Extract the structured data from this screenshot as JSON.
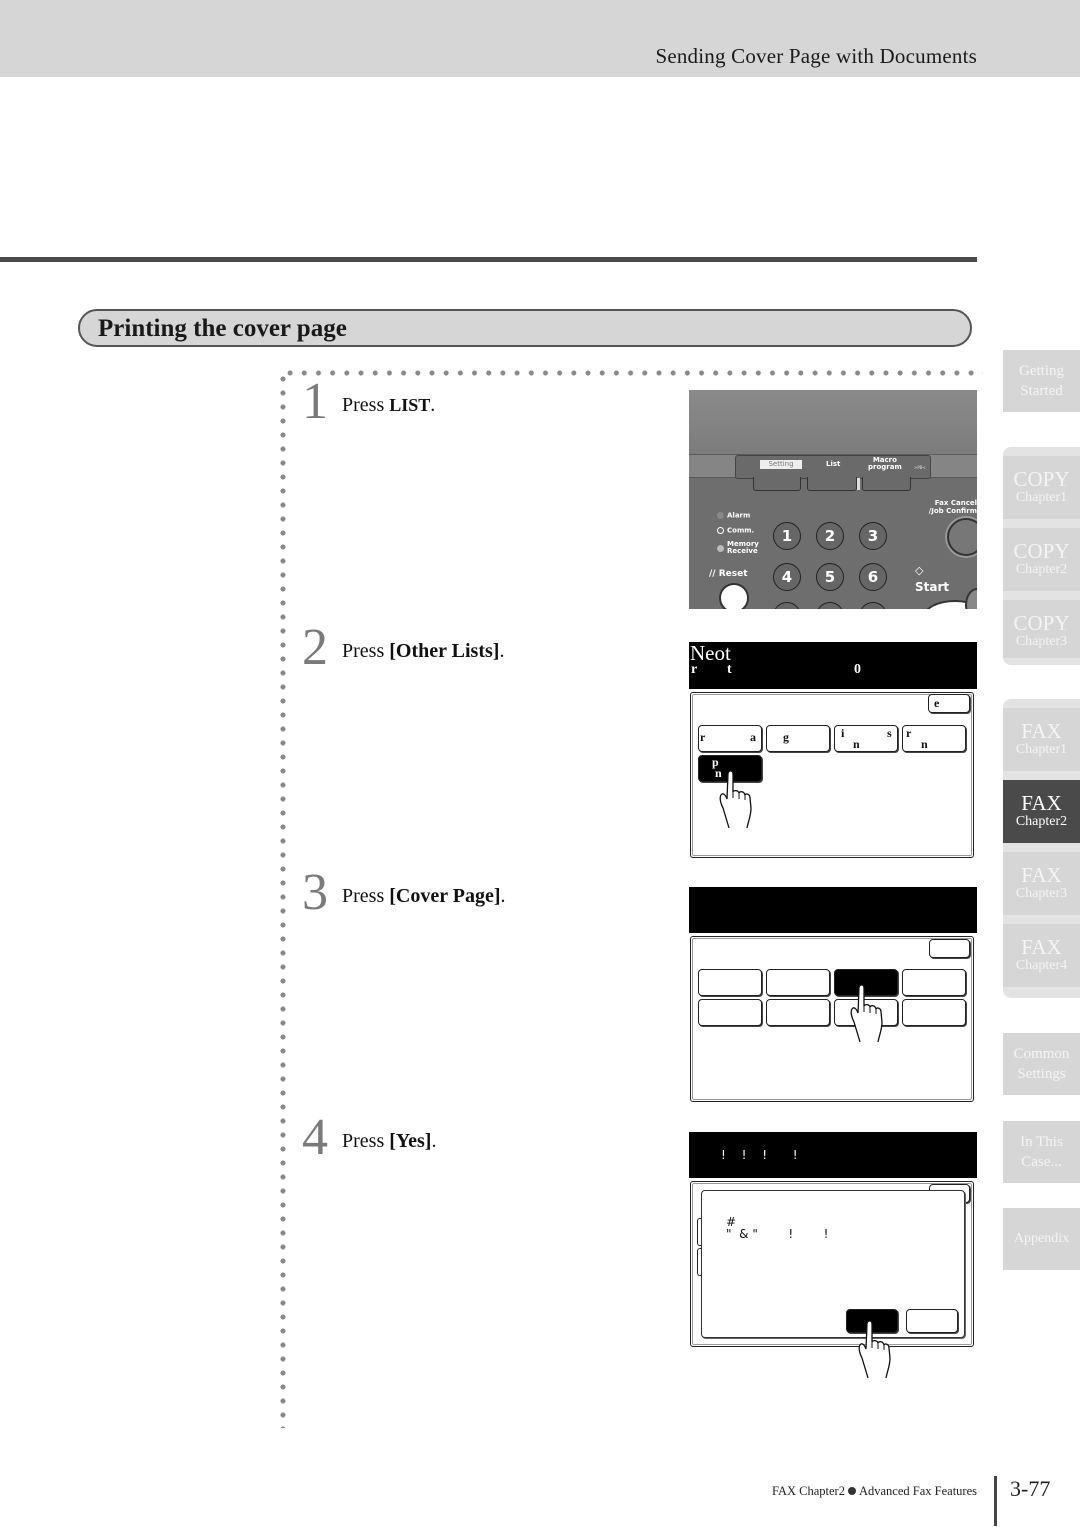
{
  "header": {
    "title": "Sending Cover Page with Documents"
  },
  "section": {
    "title": "Printing the cover page"
  },
  "steps": [
    {
      "number": "1",
      "prefix": "Press ",
      "key": "LIST",
      "suffix": "."
    },
    {
      "number": "2",
      "prefix": "Press ",
      "open": "[",
      "key": "Other Lists",
      "close": "]",
      "suffix": "."
    },
    {
      "number": "3",
      "prefix": "Press ",
      "open": "[",
      "key": "Cover Page",
      "close": "]",
      "suffix": "."
    },
    {
      "number": "4",
      "prefix": "Press ",
      "open": "[",
      "key": "Yes",
      "close": "]",
      "suffix": "."
    }
  ],
  "control_panel": {
    "keys": {
      "setting": "Setting",
      "list": "List",
      "macro_line1": "Macro",
      "macro_line2": "program",
      "pb": ">PB<"
    },
    "leds": [
      "Alarm",
      "Comm.",
      "Memory",
      "Receive"
    ],
    "number_keys": [
      "1",
      "2",
      "3",
      "4",
      "5",
      "6"
    ],
    "fax_cancel_line1": "Fax Cancel",
    "fax_cancel_line2": "/Job Confirm",
    "reset": "// Reset",
    "start": "Start"
  },
  "screen2": {
    "head_line1": "Neot",
    "head_line2a": "r",
    "head_line2b": "t",
    "head_line2c": "0",
    "close_button": "e",
    "buttons": [
      {
        "t1": "r",
        "t2": "a"
      },
      {
        "t1": "g"
      },
      {
        "t1": "i",
        "t2": "s",
        "t3": "n"
      },
      {
        "t1": "r",
        "t3": "n"
      },
      {
        "t1": "p",
        "t3": "n"
      }
    ]
  },
  "screen4": {
    "head": "! ! !  !",
    "msg_line1": "#",
    "msg_line2": "\"  & \"        !        !"
  },
  "sidebar": {
    "tabs": [
      {
        "line1": "Getting",
        "line2": "Started",
        "active": false
      },
      {
        "line1": "COPY",
        "line2": "Chapter1",
        "active": false
      },
      {
        "line1": "COPY",
        "line2": "Chapter2",
        "active": false
      },
      {
        "line1": "COPY",
        "line2": "Chapter3",
        "active": false
      },
      {
        "line1": "FAX",
        "line2": "Chapter1",
        "active": false
      },
      {
        "line1": "FAX",
        "line2": "Chapter2",
        "active": true
      },
      {
        "line1": "FAX",
        "line2": "Chapter3",
        "active": false
      },
      {
        "line1": "FAX",
        "line2": "Chapter4",
        "active": false
      },
      {
        "line1": "Common",
        "line2": "Settings",
        "active": false
      },
      {
        "line1": "In This",
        "line2": "Case...",
        "active": false
      },
      {
        "line1": "Appendix",
        "active": false
      }
    ]
  },
  "footer": {
    "chapter": "FAX Chapter2",
    "section": "Advanced Fax Features",
    "page": "3-77"
  }
}
